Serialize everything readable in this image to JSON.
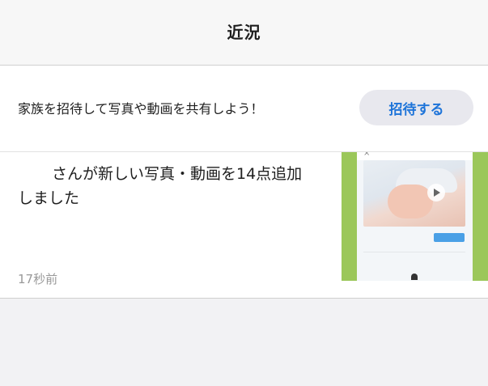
{
  "header": {
    "title": "近況"
  },
  "invite": {
    "text": "家族を招待して写真や動画を共有しよう！",
    "button_label": "招待する"
  },
  "activity": {
    "message_line1": "さんが新しい写真・動画を14点追加",
    "message_line2": "しました",
    "time": "17秒前"
  },
  "colors": {
    "accent": "#1e74d9",
    "thumb_background": "#9bc75a"
  }
}
